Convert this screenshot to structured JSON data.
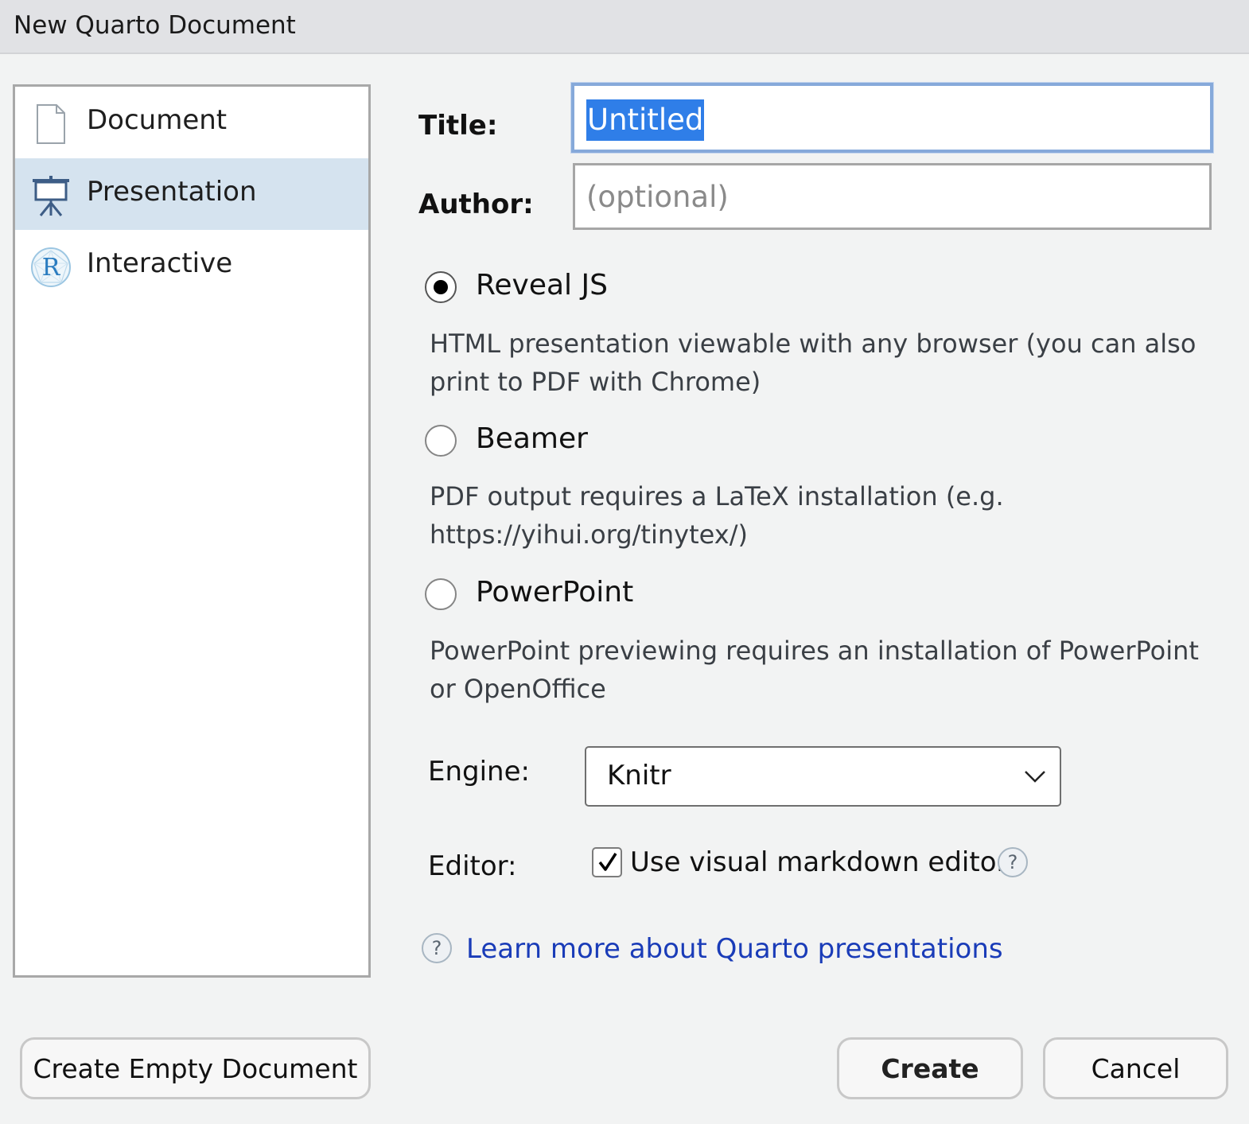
{
  "window": {
    "title": "New Quarto Document"
  },
  "templates": {
    "items": [
      {
        "label": "Document",
        "icon": "document-icon",
        "selected": false
      },
      {
        "label": "Presentation",
        "icon": "presentation-easel-icon",
        "selected": true
      },
      {
        "label": "Interactive",
        "icon": "r-logo-icon",
        "selected": false
      }
    ]
  },
  "form": {
    "title_label": "Title:",
    "title_value": "Untitled",
    "author_label": "Author:",
    "author_placeholder": "(optional)",
    "author_value": ""
  },
  "formats": [
    {
      "label": "Reveal JS",
      "checked": true,
      "description": "HTML presentation viewable with any browser (you can also print to PDF with Chrome)"
    },
    {
      "label": "Beamer",
      "checked": false,
      "description": "PDF output requires a LaTeX installation (e.g. https://yihui.org/tinytex/)"
    },
    {
      "label": "PowerPoint",
      "checked": false,
      "description": "PowerPoint previewing requires an installation of PowerPoint or OpenOffice"
    }
  ],
  "engine": {
    "label": "Engine:",
    "value": "Knitr"
  },
  "editor": {
    "label": "Editor:",
    "checkbox_label": "Use visual markdown editor",
    "checked": true,
    "help": "?"
  },
  "learn_more": {
    "help": "?",
    "text": "Learn more about Quarto presentations"
  },
  "buttons": {
    "create_empty": "Create Empty Document",
    "create": "Create",
    "cancel": "Cancel"
  },
  "colors": {
    "selection_bg": "#d5e3ef",
    "focus_border": "#86a9da",
    "text_selection": "#2f7ee8",
    "link": "#1a3cb8"
  }
}
